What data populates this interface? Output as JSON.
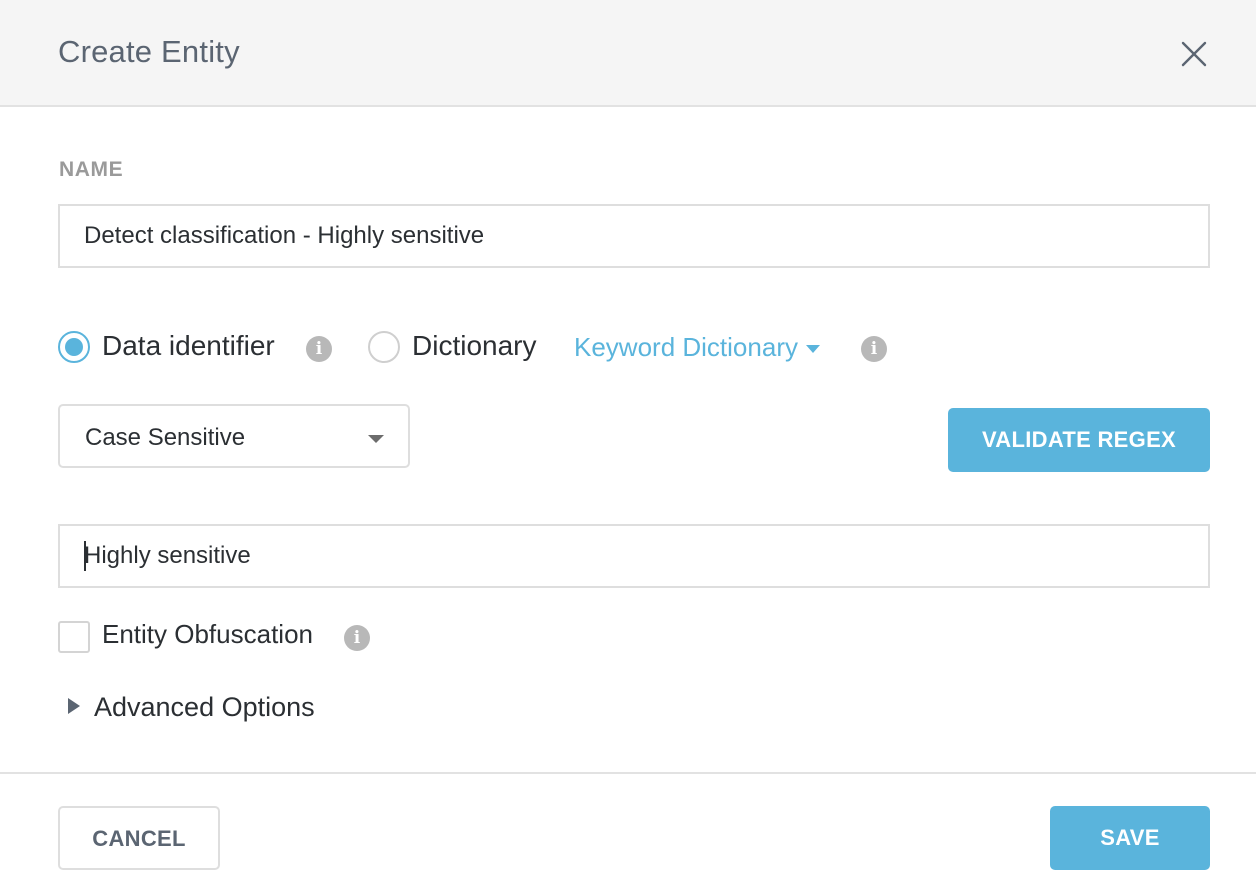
{
  "dialog": {
    "title": "Create Entity"
  },
  "form": {
    "name_label": "NAME",
    "name_value": "Detect classification - Highly sensitive",
    "type_options": {
      "data_identifier": "Data identifier",
      "dictionary": "Dictionary",
      "selected": "Data identifier"
    },
    "dictionary_dropdown": "Keyword Dictionary",
    "case_select": "Case Sensitive",
    "validate_label": "VALIDATE REGEX",
    "pattern_value": "Highly sensitive",
    "obfuscation_label": "Entity Obfuscation",
    "obfuscation_checked": false,
    "advanced_label": "Advanced Options"
  },
  "footer": {
    "cancel_label": "CANCEL",
    "save_label": "SAVE"
  },
  "icons": {
    "info": "i"
  },
  "colors": {
    "accent": "#5ab4dc",
    "title_text": "#5b6572",
    "header_bg": "#f5f5f5"
  }
}
